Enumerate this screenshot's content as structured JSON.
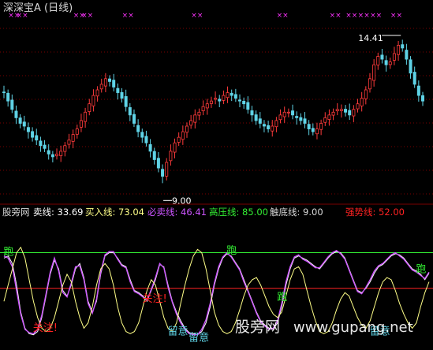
{
  "title": "深深宝A (日线)",
  "watermark": {
    "name": "股旁网",
    "url": "www.gupang.net"
  },
  "colors": {
    "up": "#ff3b3b",
    "down": "#5fd3e6",
    "grid": "#7a0000",
    "marker": "#ff33ff",
    "green": "#33ee33",
    "red": "#ff2222",
    "purple": "#cc55ff",
    "white": "#ffffff",
    "yellow": "#ffff88"
  },
  "price_panel": {
    "high_label": "14.41",
    "low_label": "9.00",
    "marker_glyph": "××"
  },
  "indicator": {
    "name": "股旁网",
    "sell_label": "卖线: 33.69",
    "buy_label": "买入线: 73.04",
    "must_sell_label": "必卖线: 46.41",
    "high_pressure_label": "高压线: 85.00",
    "bottom_label": "触底线: 9.00",
    "strong_label": "强势线: 52.00"
  },
  "signals": {
    "run": "跑",
    "attention": "关注!",
    "stay": "留意"
  },
  "chart_data": [
    {
      "type": "candlestick",
      "title": "深深宝A (日线)",
      "y_range": [
        8.5,
        15.0
      ],
      "annotations": [
        {
          "text": "14.41",
          "meaning": "high",
          "value": 14.41,
          "index": 98
        },
        {
          "text": "9.00",
          "meaning": "low",
          "value": 9.0,
          "index": 39
        }
      ],
      "closes": [
        12.3,
        12.0,
        11.7,
        11.4,
        11.2,
        11.1,
        10.9,
        10.7,
        10.6,
        10.4,
        10.3,
        10.1,
        10.0,
        10.1,
        10.2,
        10.4,
        10.6,
        10.8,
        11.0,
        11.3,
        11.6,
        11.9,
        12.2,
        12.4,
        12.6,
        12.8,
        12.7,
        12.5,
        12.3,
        12.1,
        11.8,
        11.5,
        11.2,
        10.9,
        10.7,
        10.5,
        10.2,
        9.9,
        9.6,
        9.3,
        9.8,
        10.2,
        10.5,
        10.7,
        10.9,
        11.1,
        11.3,
        11.5,
        11.6,
        11.8,
        11.9,
        12.0,
        12.1,
        12.0,
        12.2,
        12.3,
        12.2,
        12.1,
        12.0,
        11.9,
        11.7,
        11.5,
        11.3,
        11.2,
        11.1,
        11.0,
        11.1,
        11.3,
        11.5,
        11.6,
        11.6,
        11.5,
        11.4,
        11.3,
        11.2,
        11.0,
        10.9,
        11.0,
        11.2,
        11.4,
        11.5,
        11.6,
        11.7,
        11.7,
        11.6,
        11.5,
        11.7,
        11.9,
        12.1,
        12.4,
        12.8,
        13.3,
        13.6,
        13.5,
        13.3,
        13.4,
        13.7,
        14.0,
        13.9,
        13.5,
        13.0,
        12.6,
        12.2,
        12.0
      ],
      "markers_at": [
        2,
        4,
        18,
        20,
        30,
        47,
        68,
        81,
        85,
        88,
        91,
        96
      ]
    },
    {
      "type": "line",
      "title": "股旁网",
      "y_range": [
        0,
        100
      ],
      "horizontal_lines": [
        {
          "name": "高压线",
          "value": 85.0
        },
        {
          "name": "强势线",
          "value": 52.0
        }
      ],
      "series": [
        {
          "name": "卖线",
          "values": [
            80,
            82,
            75,
            55,
            30,
            15,
            10,
            9,
            12,
            25,
            45,
            65,
            78,
            70,
            50,
            45,
            55,
            70,
            75,
            62,
            40,
            30,
            40,
            65,
            82,
            85,
            85,
            80,
            74,
            72,
            60,
            50,
            48,
            45,
            40,
            50,
            60,
            74,
            72,
            55,
            40,
            30,
            22,
            15,
            11,
            10,
            9,
            12,
            20,
            35,
            55,
            70,
            80,
            84,
            82,
            76,
            70,
            60,
            50,
            40,
            30,
            22,
            18,
            15,
            14,
            20,
            35,
            55,
            70,
            80,
            82,
            80,
            78,
            75,
            72,
            70,
            75,
            80,
            84,
            86,
            85,
            80,
            70,
            60,
            50,
            48,
            52,
            58,
            66,
            72,
            74,
            78,
            82,
            84,
            83,
            80,
            75,
            70,
            68,
            65,
            60,
            66
          ]
        },
        {
          "name": "必卖线",
          "values": [
            82,
            80,
            72,
            50,
            28,
            14,
            11,
            10,
            14,
            27,
            47,
            67,
            80,
            68,
            48,
            44,
            57,
            72,
            73,
            60,
            38,
            29,
            42,
            67,
            83,
            86,
            86,
            79,
            73,
            71,
            58,
            49,
            47,
            44,
            41,
            51,
            62,
            75,
            71,
            53,
            39,
            28,
            20,
            14,
            10,
            9,
            9,
            14,
            23,
            38,
            57,
            72,
            81,
            85,
            81,
            75,
            69,
            58,
            49,
            39,
            29,
            21,
            17,
            14,
            15,
            22,
            38,
            58,
            72,
            81,
            83,
            79,
            77,
            74,
            71,
            71,
            76,
            81,
            85,
            87,
            84,
            79,
            69,
            59,
            49,
            47,
            53,
            60,
            68,
            73,
            75,
            79,
            83,
            85,
            82,
            79,
            74,
            69,
            67,
            64,
            61,
            67
          ]
        },
        {
          "name": "买入线",
          "values": [
            40,
            55,
            70,
            85,
            90,
            80,
            60,
            40,
            25,
            15,
            12,
            15,
            25,
            40,
            55,
            65,
            58,
            40,
            25,
            15,
            20,
            35,
            55,
            70,
            75,
            70,
            55,
            35,
            20,
            12,
            10,
            12,
            20,
            35,
            50,
            60,
            55,
            40,
            25,
            15,
            12,
            20,
            38,
            55,
            70,
            82,
            88,
            85,
            70,
            50,
            30,
            18,
            12,
            10,
            12,
            20,
            32,
            45,
            55,
            60,
            62,
            55,
            45,
            35,
            28,
            25,
            30,
            45,
            60,
            70,
            72,
            65,
            50,
            35,
            22,
            12,
            10,
            12,
            20,
            32,
            42,
            48,
            45,
            35,
            25,
            18,
            15,
            22,
            35,
            48,
            58,
            62,
            60,
            50,
            38,
            28,
            20,
            15,
            20,
            35,
            48,
            58
          ]
        }
      ],
      "signals": [
        {
          "text": "跑",
          "index": 1
        },
        {
          "text": "关注!",
          "index": 8
        },
        {
          "text": "关注!",
          "index": 34
        },
        {
          "text": "留意",
          "index": 40
        },
        {
          "text": "留意",
          "index": 45
        },
        {
          "text": "跑",
          "index": 54
        },
        {
          "text": "跑",
          "index": 66
        },
        {
          "text": "留意",
          "index": 88
        },
        {
          "text": "跑",
          "index": 99
        }
      ]
    }
  ]
}
